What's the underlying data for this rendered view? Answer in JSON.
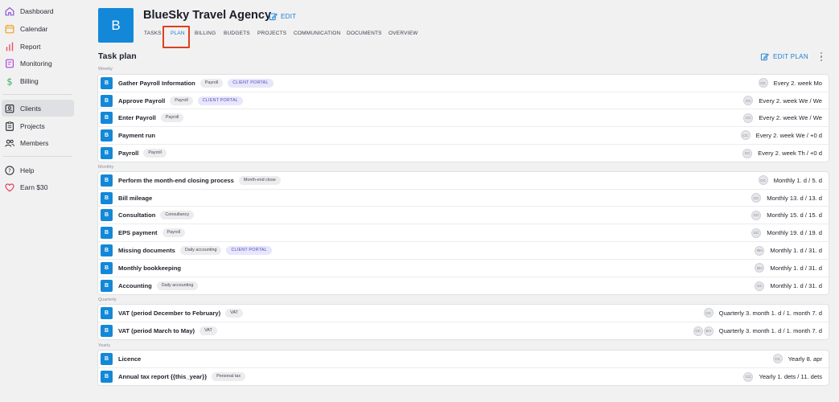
{
  "sidebar": {
    "items": [
      {
        "label": "Dashboard",
        "icon": "home-icon"
      },
      {
        "label": "Calendar",
        "icon": "calendar-icon"
      },
      {
        "label": "Report",
        "icon": "bar-chart-icon"
      },
      {
        "label": "Monitoring",
        "icon": "monitor-icon"
      },
      {
        "label": "Billing",
        "icon": "dollar-icon"
      },
      {
        "label": "Clients",
        "icon": "contact-card-icon",
        "active": true
      },
      {
        "label": "Projects",
        "icon": "clipboard-icon"
      },
      {
        "label": "Members",
        "icon": "people-icon"
      },
      {
        "label": "Help",
        "icon": "help-circle-icon"
      },
      {
        "label": "Earn $30",
        "icon": "heart-icon"
      }
    ]
  },
  "header": {
    "avatar_letter": "B",
    "title": "BlueSky Travel Agency",
    "edit_label": "EDIT",
    "tabs": [
      {
        "label": "TASKS"
      },
      {
        "label": "PLAN",
        "active": true
      },
      {
        "label": "BILLING"
      },
      {
        "label": "BUDGETS"
      },
      {
        "label": "PROJECTS"
      },
      {
        "label": "COMMUNICATION"
      },
      {
        "label": "DOCUMENTS"
      },
      {
        "label": "OVERVIEW"
      }
    ]
  },
  "plan": {
    "title": "Task plan",
    "edit_plan_label": "EDIT PLAN",
    "groups": [
      {
        "label": "Weekly",
        "tasks": [
          {
            "icon": "B",
            "name": "Gather Payroll Information",
            "tags": [
              {
                "text": "Payroll"
              },
              {
                "text": "CLIENT PORTAL",
                "portal": true
              }
            ],
            "assignees": [
              "CC"
            ],
            "schedule": "Every 2. week Mo"
          },
          {
            "icon": "B",
            "name": "Approve Payroll",
            "tags": [
              {
                "text": "Payroll"
              },
              {
                "text": "CLIENT PORTAL",
                "portal": true
              }
            ],
            "assignees": [
              "CC"
            ],
            "schedule": "Every 2. week We / We"
          },
          {
            "icon": "B",
            "name": "Enter Payroll",
            "tags": [
              {
                "text": "Payroll"
              }
            ],
            "assignees": [
              "CC"
            ],
            "schedule": "Every 2. week We / We"
          },
          {
            "icon": "B",
            "name": "Payment run",
            "tags": [],
            "assignees": [
              "CC"
            ],
            "schedule": "Every 2. week We / +0 d"
          },
          {
            "icon": "B",
            "name": "Payroll",
            "tags": [
              {
                "text": "Payroll"
              }
            ],
            "assignees": [
              "CC"
            ],
            "schedule": "Every 2. week Th / +0 d"
          }
        ]
      },
      {
        "label": "Monthly",
        "tasks": [
          {
            "icon": "B",
            "name": "Perform the month-end closing process",
            "tags": [
              {
                "text": "Month-end close"
              }
            ],
            "assignees": [
              "CC"
            ],
            "schedule": "Monthly 1. d / 5. d"
          },
          {
            "icon": "B",
            "name": "Bill mileage",
            "tags": [],
            "assignees": [
              "CC"
            ],
            "schedule": "Monthly 13. d / 13. d"
          },
          {
            "icon": "B",
            "name": "Consultation",
            "tags": [
              {
                "text": "Consultancy"
              }
            ],
            "assignees": [
              "CC"
            ],
            "schedule": "Monthly 15. d / 15. d"
          },
          {
            "icon": "B",
            "name": "EPS payment",
            "tags": [
              {
                "text": "Payroll"
              }
            ],
            "assignees": [
              "CC"
            ],
            "schedule": "Monthly 19. d / 19. d"
          },
          {
            "icon": "B",
            "name": "Missing documents",
            "tags": [
              {
                "text": "Daily accounting"
              },
              {
                "text": "CLIENT PORTAL",
                "portal": true
              }
            ],
            "assignees": [
              "EH"
            ],
            "schedule": "Monthly 1. d / 31. d"
          },
          {
            "icon": "B",
            "name": "Monthly bookkeeping",
            "tags": [],
            "assignees": [
              "EH"
            ],
            "schedule": "Monthly 1. d / 31. d"
          },
          {
            "icon": "B",
            "name": "Accounting",
            "tags": [
              {
                "text": "Daily accounting"
              }
            ],
            "assignees": [
              "CC"
            ],
            "schedule": "Monthly 1. d / 31. d"
          }
        ]
      },
      {
        "label": "Quarterly",
        "tasks": [
          {
            "icon": "B",
            "name": "VAT (period December to February)",
            "tags": [
              {
                "text": "VAT"
              }
            ],
            "assignees": [
              "CC"
            ],
            "schedule": "Quarterly 3. month 1. d / 1. month 7. d"
          },
          {
            "icon": "B",
            "name": "VAT (period March to May)",
            "tags": [
              {
                "text": "VAT"
              }
            ],
            "assignees": [
              "CC",
              "EH"
            ],
            "schedule": "Quarterly 3. month 1. d / 1. month 7. d"
          }
        ]
      },
      {
        "label": "Yearly",
        "tasks": [
          {
            "icon": "B",
            "name": "Licence",
            "tags": [],
            "assignees": [
              "CC"
            ],
            "schedule": "Yearly 8. apr"
          },
          {
            "icon": "B",
            "name": "Annual tax report {{this_year}}",
            "tags": [
              {
                "text": "Personal tax"
              }
            ],
            "assignees": [
              "CC"
            ],
            "schedule": "Yearly 1. dets / 11. dets"
          }
        ]
      }
    ]
  },
  "colors": {
    "accent": "#1a7fd0",
    "avatar": "#1488d8",
    "highlight": "#e0401c",
    "portal_tag_bg": "#e7e6fb",
    "portal_tag_text": "#5150c4"
  }
}
